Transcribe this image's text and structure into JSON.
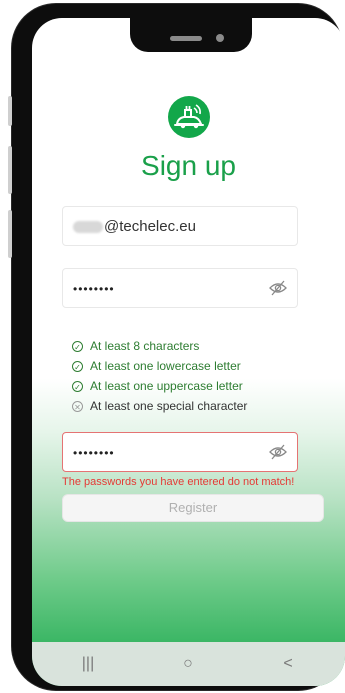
{
  "title": "Sign up",
  "email_field": {
    "value": "@techelec.eu"
  },
  "password_field": {
    "value": "••••••••"
  },
  "rules": [
    {
      "text": "At least 8 characters",
      "status": "ok"
    },
    {
      "text": "At least one lowercase letter",
      "status": "ok"
    },
    {
      "text": "At least one uppercase letter",
      "status": "ok"
    },
    {
      "text": "At least one special character",
      "status": "fail"
    }
  ],
  "confirm_field": {
    "value": "••••••••"
  },
  "error_message": "The passwords you have entered do not match!",
  "register_button": {
    "label": "Register"
  },
  "icons": {
    "logo": "car-plug-logo-icon",
    "eye": "eye-off-icon",
    "rule_ok": "check-circle-icon",
    "rule_fail": "x-circle-icon"
  },
  "colors": {
    "brand_green": "#1aa04a",
    "rule_ok": "#2e7d32",
    "error_red": "#e53935",
    "button_disabled": "#f5f5f5"
  },
  "navbar": {
    "recents_glyph": "|||",
    "home_glyph": "○",
    "back_glyph": "<"
  }
}
